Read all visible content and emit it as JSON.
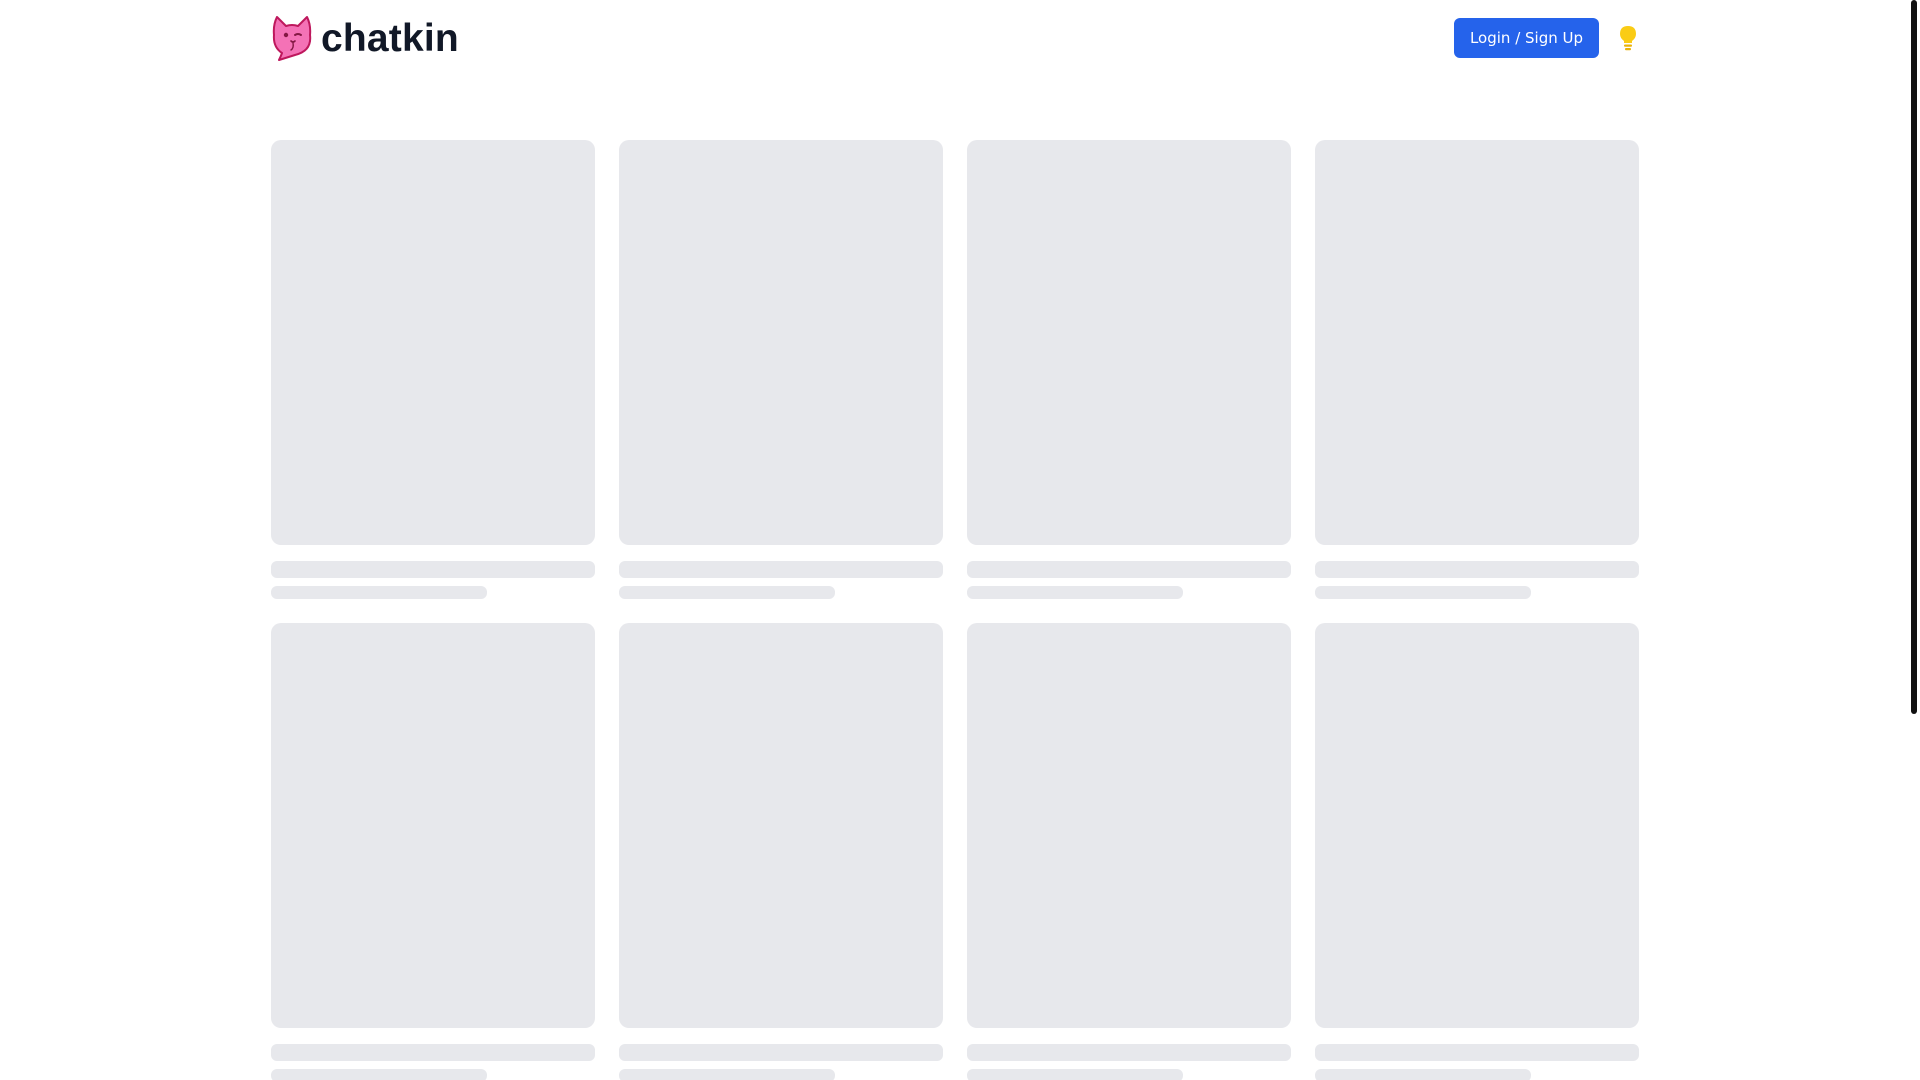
{
  "header": {
    "brand_name": "chatkin",
    "logo_icon": "cat-speech-bubble-icon",
    "login_label": "Login / Sign Up",
    "theme_icon": "lightbulb-icon"
  },
  "colors": {
    "accent": "#2563eb",
    "logo_pink": "#f472b6",
    "skeleton": "#e7e8ec",
    "bulb": "#facc15"
  },
  "grid": {
    "cards": [
      {
        "state": "loading"
      },
      {
        "state": "loading"
      },
      {
        "state": "loading"
      },
      {
        "state": "loading"
      },
      {
        "state": "loading"
      },
      {
        "state": "loading"
      },
      {
        "state": "loading"
      },
      {
        "state": "loading"
      }
    ]
  }
}
